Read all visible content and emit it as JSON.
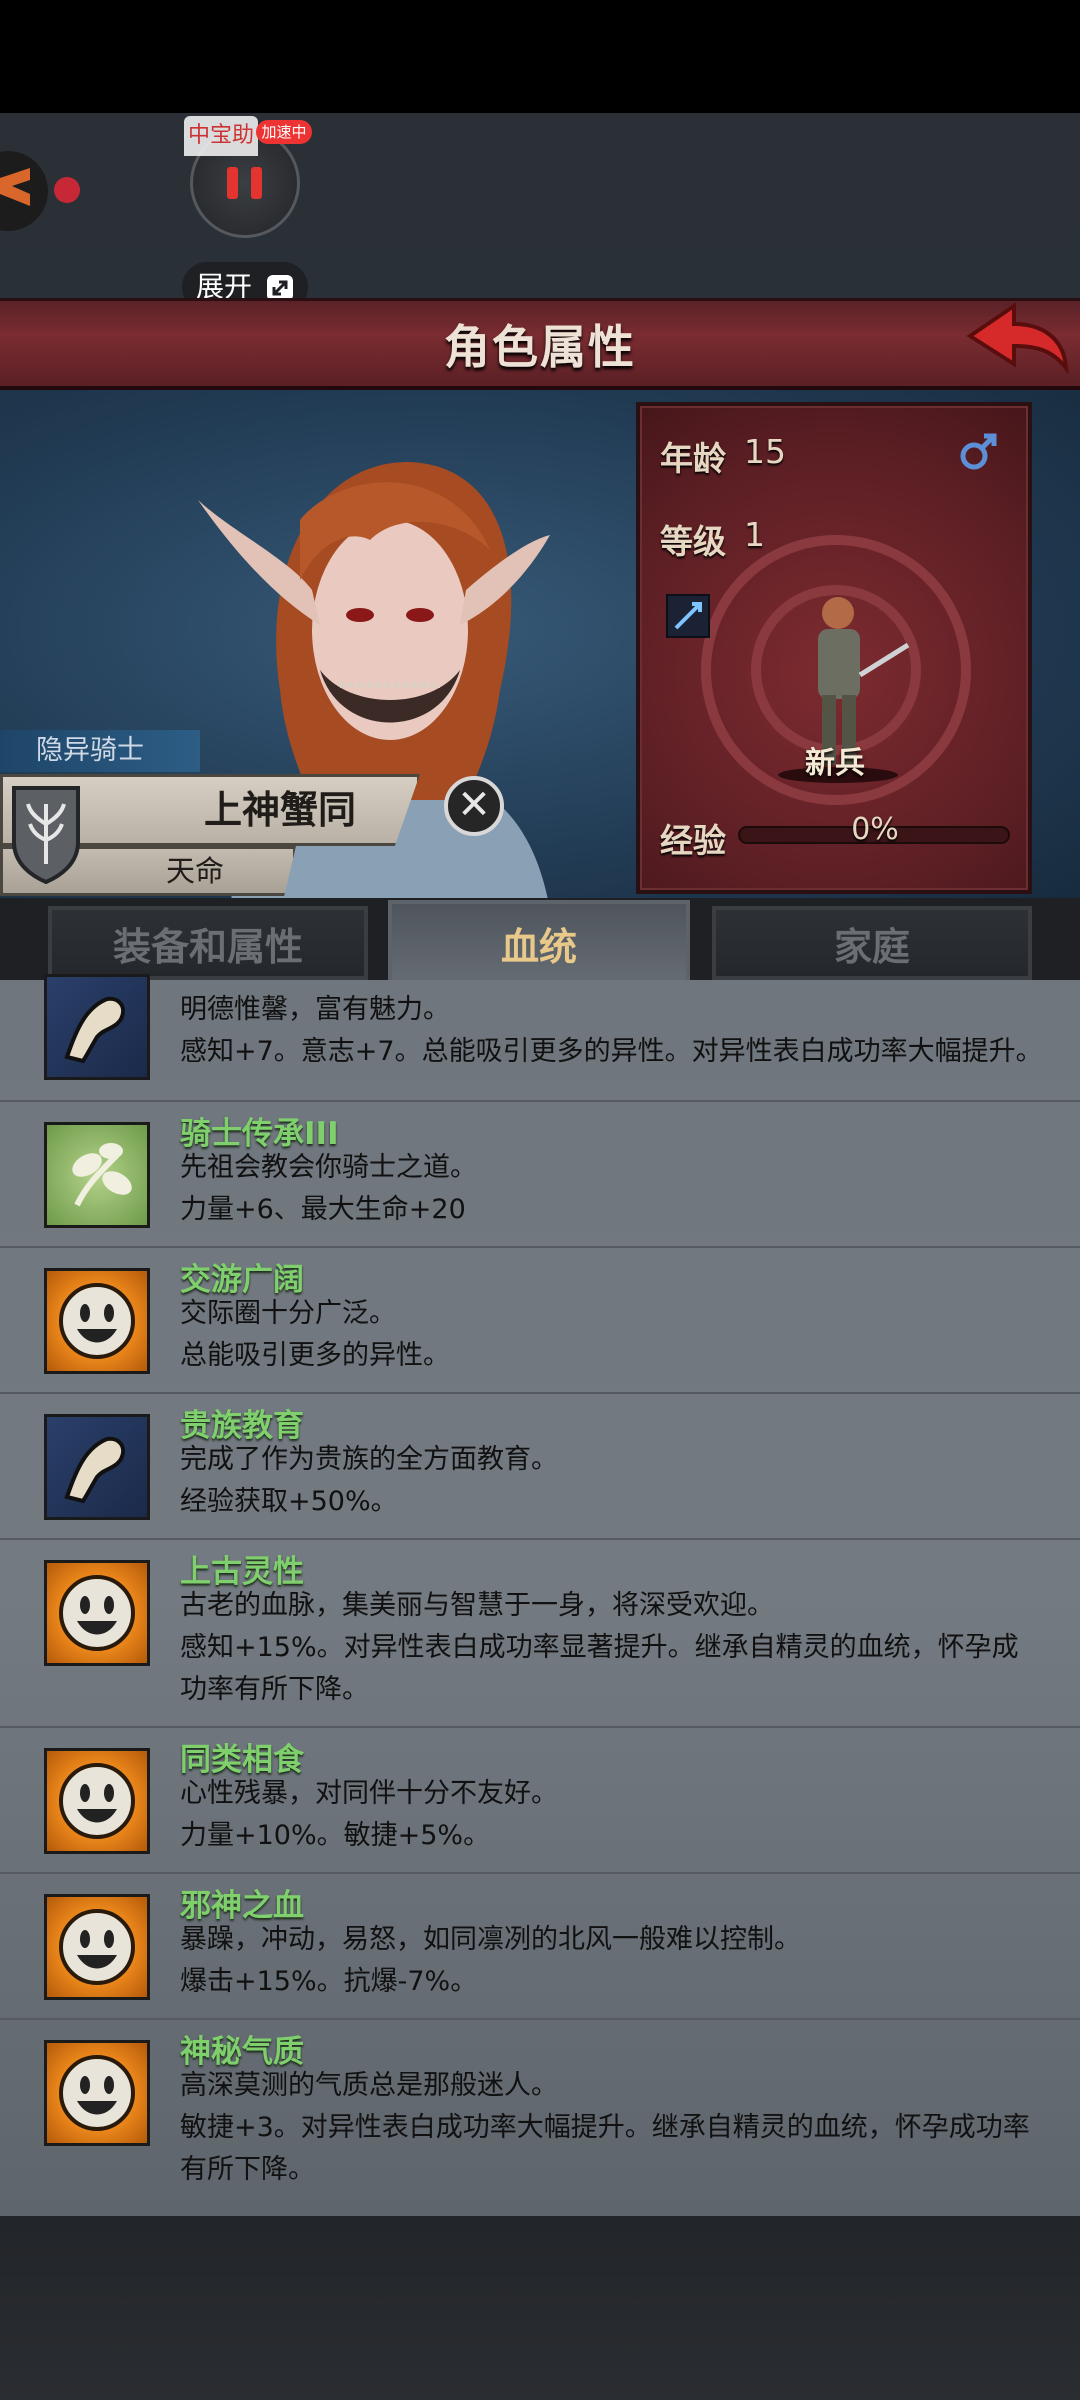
{
  "overlay": {
    "float_label": "中宝助",
    "speed_badge": "加速中",
    "expand_label": "展开"
  },
  "header": {
    "title": "角色属性"
  },
  "character": {
    "class_tag": "隐异骑士",
    "name": "上神蟹同",
    "fate": "天命",
    "age_label": "年龄",
    "age_value": "15",
    "level_label": "等级",
    "level_value": "1",
    "rank": "新兵",
    "exp_label": "经验",
    "exp_value": "0%",
    "gender_icon": "male-icon"
  },
  "tabs": [
    {
      "label": "装备和属性",
      "active": false
    },
    {
      "label": "血统",
      "active": true
    },
    {
      "label": "家庭",
      "active": false
    }
  ],
  "traits": [
    {
      "icon": "arm-icon",
      "name": "",
      "line1": "明德惟馨，富有魅力。",
      "line2": "感知+7。意志+7。总能吸引更多的异性。对异性表白成功率大幅提升。",
      "line3": ""
    },
    {
      "icon": "leaf-icon",
      "name": "骑士传承III",
      "line1": "先祖会教会你骑士之道。",
      "line2": "力量+6、最大生命+20",
      "line3": ""
    },
    {
      "icon": "smile-icon",
      "name": "交游广阔",
      "line1": "交际圈十分广泛。",
      "line2": "总能吸引更多的异性。",
      "line3": ""
    },
    {
      "icon": "arm-icon",
      "name": "贵族教育",
      "line1": "完成了作为贵族的全方面教育。",
      "line2": "经验获取+50%。",
      "line3": ""
    },
    {
      "icon": "smile-icon",
      "name": "上古灵性",
      "line1": "古老的血脉，集美丽与智慧于一身，将深受欢迎。",
      "line2": "感知+15%。对异性表白成功率显著提升。继承自精灵的血统，怀孕成",
      "line3": "功率有所下降。"
    },
    {
      "icon": "smile-icon",
      "name": "同类相食",
      "line1": "心性残暴，对同伴十分不友好。",
      "line2": "力量+10%。敏捷+5%。",
      "line3": ""
    },
    {
      "icon": "smile-icon",
      "name": "邪神之血",
      "line1": "暴躁，冲动，易怒，如同凛冽的北风一般难以控制。",
      "line2": "爆击+15%。抗爆-7%。",
      "line3": ""
    },
    {
      "icon": "smile-icon",
      "name": "神秘气质",
      "line1": "高深莫测的气质总是那般迷人。",
      "line2": "敏捷+3。对异性表白成功率大幅提升。继承自精灵的血统，怀孕成功率",
      "line3": "有所下降。"
    }
  ],
  "colors": {
    "banner": "#7a2c31",
    "trait_name": "#7fd06d",
    "active_tab_text": "#e9c98a"
  }
}
